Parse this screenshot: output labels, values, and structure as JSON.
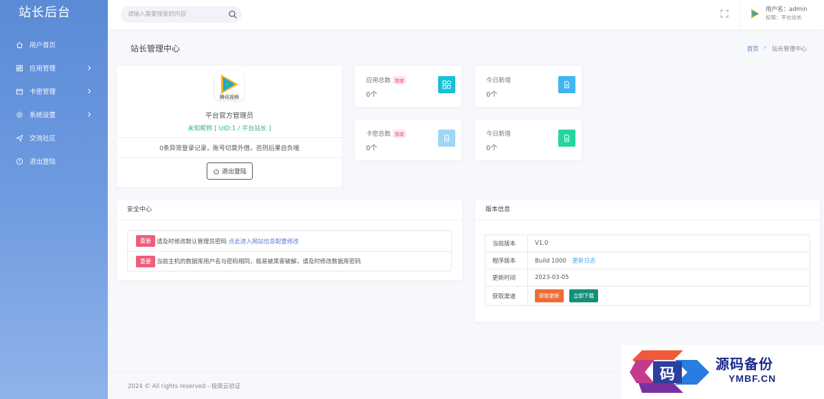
{
  "sidebar": {
    "brand": "站长后台",
    "items": [
      {
        "label": "用户首页",
        "icon": "home-icon"
      },
      {
        "label": "应用管理",
        "icon": "apps-icon"
      },
      {
        "label": "卡密管理",
        "icon": "card-icon"
      },
      {
        "label": "系统设置",
        "icon": "gear-icon"
      },
      {
        "label": "交流社区",
        "icon": "send-icon"
      },
      {
        "label": "退出登陆",
        "icon": "power-icon"
      }
    ]
  },
  "topbar": {
    "search_placeholder": "请输入需要搜索的内容",
    "user_name": "用户名：admin",
    "user_role": "权限：平台站长"
  },
  "page": {
    "title": "站长管理中心",
    "breadcrumb_home": "首页",
    "breadcrumb_sep": "›",
    "breadcrumb_current": "站长管理中心"
  },
  "profile": {
    "logo_caption": "腾讯视频",
    "name": "平台官方管理员",
    "nick": "未知昵称 [ UID:1 / 平台站长 ]",
    "warning": "0条异常登录记录，账号切莫外借，否则后果自负哦",
    "logout_label": "退出登陆"
  },
  "stats": [
    {
      "label": "应用总数",
      "badge": "管理",
      "value": "0个",
      "color": "#17c1d9"
    },
    {
      "label": "今日新增",
      "badge": "",
      "value": "0个",
      "color": "#3fb6f0"
    },
    {
      "label": "卡密总数",
      "badge": "管理",
      "value": "0个",
      "color": "#9fd7f6"
    },
    {
      "label": "今日新增",
      "badge": "",
      "value": "0个",
      "color": "#25d6a0"
    }
  ],
  "security": {
    "title": "安全中心",
    "tag": "重要",
    "row1_text": "请及时修改默认管理员密码",
    "row1_link": "点此进入网站信息配置修改",
    "row2_text": "当前主机的数据库用户名与密码相同，极易被黑客破解，请及时修改数据库密码"
  },
  "version": {
    "title": "版本信息",
    "rows": [
      {
        "key": "当前版本",
        "value": "V1.0"
      },
      {
        "key": "程序版本",
        "value": "Build 1000",
        "link": "更新日志"
      },
      {
        "key": "更新时间",
        "value": "2023-03-05"
      },
      {
        "key": "获取渠道"
      }
    ],
    "btn_update": "获取更新",
    "btn_download": "立即下载"
  },
  "footer": "2024 © All rights reserved - 极简云验证",
  "watermark": {
    "line1": "源码备份",
    "line2": "YMBF.CN",
    "mark": "码"
  }
}
